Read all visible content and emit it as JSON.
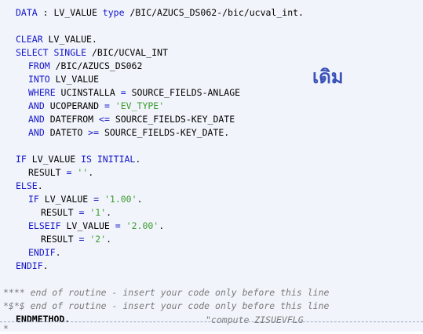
{
  "code": {
    "data_kw": "DATA",
    "data_rest": " : LV_VALUE ",
    "type_kw": "type",
    "type_rest": " /BIC/AZUCS_DS062-/bic/ucval_int.",
    "clear_kw": "CLEAR",
    "clear_rest": " LV_VALUE.",
    "select_kw": "SELECT SINGLE",
    "select_rest": " /BIC/UCVAL_INT",
    "from_kw": "FROM",
    "from_rest": " /BIC/AZUCS_DS062",
    "into_kw": "INTO",
    "into_rest": " LV_VALUE",
    "where_kw": "WHERE",
    "where_rest": " UCINSTALLA ",
    "where_op": "=",
    "where_tail": " SOURCE_FIELDS-ANLAGE",
    "and1_kw": "AND",
    "and1_rest": " UCOPERAND ",
    "and1_op": "=",
    "and1_str": "'EV_TYPE'",
    "and2_kw": "AND",
    "and2_rest": " DATEFROM ",
    "and2_op": "<=",
    "and2_tail": " SOURCE_FIELDS-KEY_DATE",
    "and3_kw": "AND",
    "and3_rest": " DATETO ",
    "and3_op": ">=",
    "and3_tail": " SOURCE_FIELDS-KEY_DATE.",
    "if_kw": "IF",
    "if_rest": " LV_VALUE ",
    "if_kw2": "IS INITIAL",
    "if_tail": ".",
    "result1_rest": "RESULT ",
    "result1_op": "=",
    "result1_str": "''",
    "result1_tail": ".",
    "else_kw": "ELSE",
    "else_tail": ".",
    "if2_kw": "IF",
    "if2_rest": " LV_VALUE ",
    "if2_op": "=",
    "if2_str": "'1.00'",
    "if2_tail": ".",
    "result2_rest": "RESULT ",
    "result2_op": "=",
    "result2_str": "'1'",
    "result2_tail": ".",
    "elseif_kw": "ELSEIF",
    "elseif_rest": " LV_VALUE ",
    "elseif_op": "=",
    "elseif_str": "'2.00'",
    "elseif_tail": ".",
    "result3_rest": "RESULT ",
    "result3_op": "=",
    "result3_str": "'2'",
    "result3_tail": ".",
    "endif_inner_kw": "ENDIF",
    "endif_inner_tail": ".",
    "endif_outer_kw": "ENDIF",
    "endif_outer_tail": ".",
    "comment1": "**** end of routine - insert your code only before this line",
    "comment2": "*$*$ end of routine - insert your code only before this line",
    "endmethod": "ENDMETHOD.",
    "endmethod_comment": "\"compute ZISUEVFLG",
    "trailing_comment": "*"
  },
  "overlay_label": "เดิม",
  "colors": {
    "keyword": "#1515c8",
    "string": "#3c9a2e",
    "comment": "#7a7a7a",
    "background": "#f1f5fb",
    "overlay": "#3b52b8"
  }
}
